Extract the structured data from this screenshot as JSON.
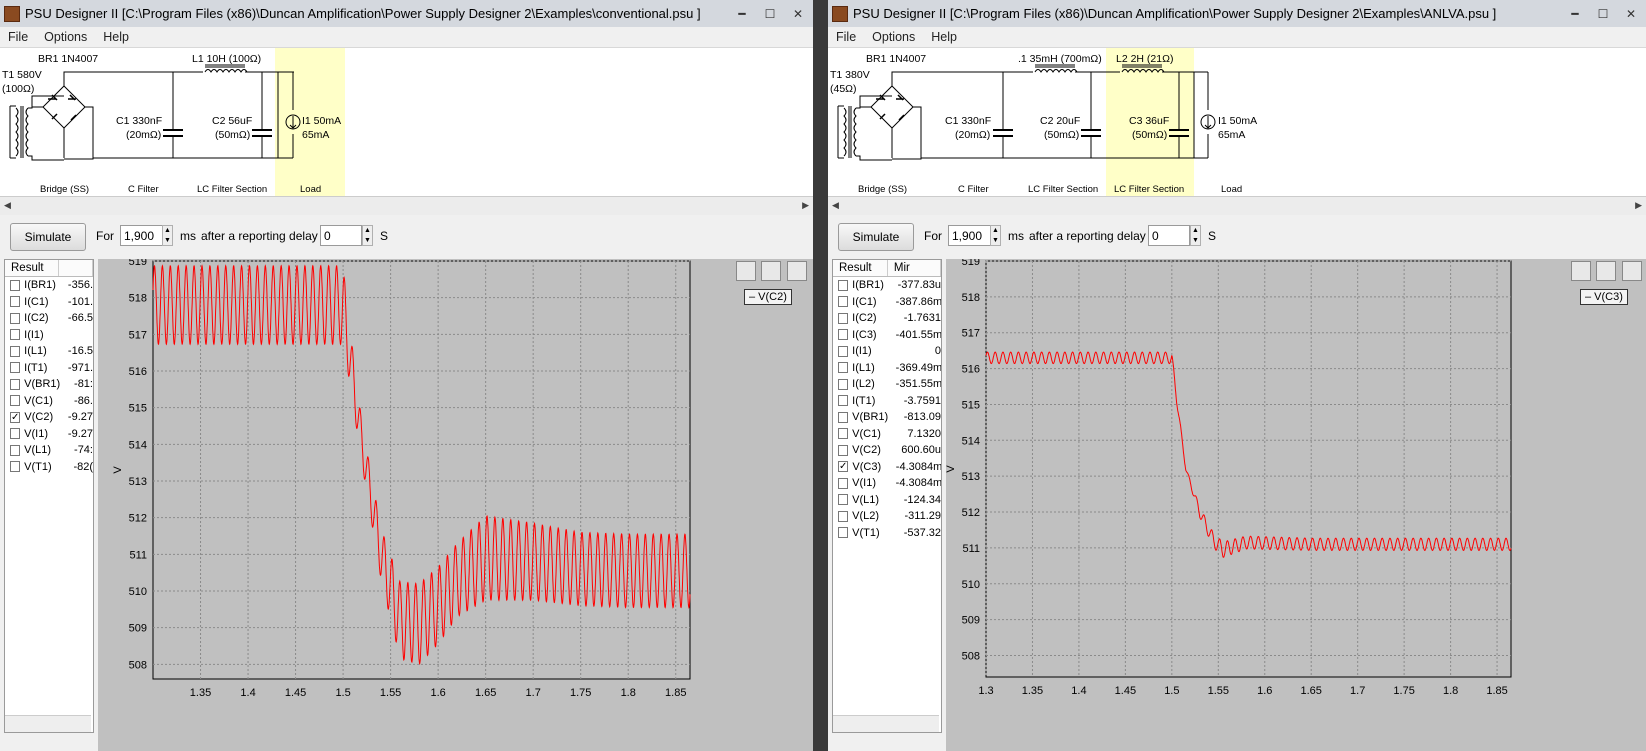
{
  "left": {
    "title": "PSU Designer II  [C:\\Program Files (x86)\\Duncan Amplification\\Power Supply Designer 2\\Examples\\conventional.psu ]",
    "menu": [
      "File",
      "Options",
      "Help"
    ],
    "schematic": {
      "t1_a": "T1 580V",
      "t1_b": "(100Ω)",
      "br1": "BR1 1N4007",
      "l1": "L1 10H (100Ω)",
      "c1_a": "C1 330nF",
      "c1_b": "(20mΩ)",
      "c2_a": "C2 56uF",
      "c2_b": "(50mΩ)",
      "i1_a": "I1 50mA",
      "i1_b": "65mA",
      "sec_bridge": "Bridge (SS)",
      "sec_cfilter": "C Filter",
      "sec_lc": "LC Filter Section",
      "sec_load": "Load"
    },
    "toolbar": {
      "simulate": "Simulate",
      "for": "For",
      "duration": "1,900",
      "ms": "ms",
      "after": "after a reporting delay of",
      "delay": "0",
      "s": "S"
    },
    "results": {
      "headers": [
        "Result",
        ""
      ],
      "rows": [
        {
          "name": "I(BR1)",
          "value": "-356.",
          "checked": false
        },
        {
          "name": "I(C1)",
          "value": "-101.",
          "checked": false
        },
        {
          "name": "I(C2)",
          "value": "-66.5",
          "checked": false
        },
        {
          "name": "I(I1)",
          "value": "",
          "checked": false
        },
        {
          "name": "I(L1)",
          "value": "-16.5",
          "checked": false
        },
        {
          "name": "I(T1)",
          "value": "-971.",
          "checked": false
        },
        {
          "name": "V(BR1)",
          "value": "-81:",
          "checked": false
        },
        {
          "name": "V(C1)",
          "value": "-86.",
          "checked": false
        },
        {
          "name": "V(C2)",
          "value": "-9.27",
          "checked": true
        },
        {
          "name": "V(I1)",
          "value": "-9.27",
          "checked": false
        },
        {
          "name": "V(L1)",
          "value": "-74:",
          "checked": false
        },
        {
          "name": "V(T1)",
          "value": "-82(",
          "checked": false
        }
      ]
    },
    "legend": "– V(C2)",
    "chart_data": {
      "type": "line",
      "ylabel": "V",
      "xlim": [
        1.3,
        1.865
      ],
      "ylim": [
        507.6,
        519
      ],
      "xticks": [
        "1.35",
        "1.4",
        "1.45",
        "1.5",
        "1.55",
        "1.6",
        "1.65",
        "1.7",
        "1.75",
        "1.8",
        "1.85"
      ],
      "yticks": [
        "519",
        "518",
        "517",
        "516",
        "515",
        "514",
        "513",
        "512",
        "511",
        "510",
        "509",
        "508"
      ],
      "series": [
        {
          "color": "#ff0000"
        }
      ],
      "ripple_period": 0.00833,
      "envelope": {
        "t": [
          1.3,
          1.5,
          1.505,
          1.52,
          1.54,
          1.56,
          1.58,
          1.6,
          1.62,
          1.65,
          1.7,
          1.75,
          1.8,
          1.865
        ],
        "center": [
          517.8,
          517.8,
          516.8,
          514.0,
          511.0,
          509.2,
          509.1,
          509.6,
          510.3,
          510.9,
          510.8,
          510.6,
          510.55,
          510.55
        ],
        "half_amplitude": [
          1.07,
          1.07,
          0.8,
          0.55,
          0.7,
          1.05,
          1.1,
          1.05,
          1.0,
          1.15,
          1.05,
          1.0,
          1.0,
          1.0
        ]
      }
    }
  },
  "right": {
    "title": "PSU Designer II  [C:\\Program Files (x86)\\Duncan Amplification\\Power Supply Designer 2\\Examples\\ANLVA.psu ]",
    "menu": [
      "File",
      "Options",
      "Help"
    ],
    "schematic": {
      "t1_a": "T1 380V",
      "t1_b": "(45Ω)",
      "br1": "BR1 1N4007",
      "l1": ".1 35mH (700mΩ)",
      "l2": "L2 2H (21Ω)",
      "c1_a": "C1 330nF",
      "c1_b": "(20mΩ)",
      "c2_a": "C2 20uF",
      "c2_b": "(50mΩ)",
      "c3_a": "C3 36uF",
      "c3_b": "(50mΩ)",
      "i1_a": "I1 50mA",
      "i1_b": "65mA",
      "sec_bridge": "Bridge (SS)",
      "sec_cfilter": "C Filter",
      "sec_lc1": "LC Filter Section",
      "sec_lc2": "LC Filter Section",
      "sec_load": "Load"
    },
    "toolbar": {
      "simulate": "Simulate",
      "for": "For",
      "duration": "1,900",
      "ms": "ms",
      "after": "after a reporting delay of",
      "delay": "0",
      "s": "S"
    },
    "results": {
      "headers": [
        "Result",
        "Mir"
      ],
      "rows": [
        {
          "name": "I(BR1)",
          "value": "-377.83u",
          "checked": false
        },
        {
          "name": "I(C1)",
          "value": "-387.86m",
          "checked": false
        },
        {
          "name": "I(C2)",
          "value": "-1.7631",
          "checked": false
        },
        {
          "name": "I(C3)",
          "value": "-401.55m",
          "checked": false
        },
        {
          "name": "I(I1)",
          "value": "0",
          "checked": false
        },
        {
          "name": "I(L1)",
          "value": "-369.49m",
          "checked": false
        },
        {
          "name": "I(L2)",
          "value": "-351.55m",
          "checked": false
        },
        {
          "name": "I(T1)",
          "value": "-3.7591",
          "checked": false
        },
        {
          "name": "V(BR1)",
          "value": "-813.09",
          "checked": false
        },
        {
          "name": "V(C1)",
          "value": "7.1320",
          "checked": false
        },
        {
          "name": "V(C2)",
          "value": "600.60u",
          "checked": false
        },
        {
          "name": "V(C3)",
          "value": "-4.3084m",
          "checked": true
        },
        {
          "name": "V(I1)",
          "value": "-4.3084m",
          "checked": false
        },
        {
          "name": "V(L1)",
          "value": "-124.34",
          "checked": false
        },
        {
          "name": "V(L2)",
          "value": "-311.29",
          "checked": false
        },
        {
          "name": "V(T1)",
          "value": "-537.32",
          "checked": false
        }
      ]
    },
    "legend": "– V(C3)",
    "chart_data": {
      "type": "line",
      "ylabel": "V",
      "xlim": [
        1.3,
        1.865
      ],
      "ylim": [
        507.4,
        519
      ],
      "xticks": [
        "1.3",
        "1.35",
        "1.4",
        "1.45",
        "1.5",
        "1.55",
        "1.6",
        "1.65",
        "1.7",
        "1.75",
        "1.8",
        "1.85"
      ],
      "yticks": [
        "519",
        "518",
        "517",
        "516",
        "515",
        "514",
        "513",
        "512",
        "511",
        "510",
        "509",
        "508"
      ],
      "series": [
        {
          "color": "#ff0000"
        }
      ],
      "ripple_period": 0.00833,
      "envelope": {
        "t": [
          1.3,
          1.5,
          1.505,
          1.515,
          1.53,
          1.545,
          1.555,
          1.58,
          1.65,
          1.865
        ],
        "center": [
          516.3,
          516.3,
          515.2,
          513.2,
          512.0,
          511.2,
          510.95,
          511.15,
          511.1,
          511.1
        ],
        "half_amplitude": [
          0.16,
          0.16,
          0.12,
          0.05,
          0.15,
          0.2,
          0.22,
          0.18,
          0.17,
          0.17
        ]
      }
    }
  }
}
